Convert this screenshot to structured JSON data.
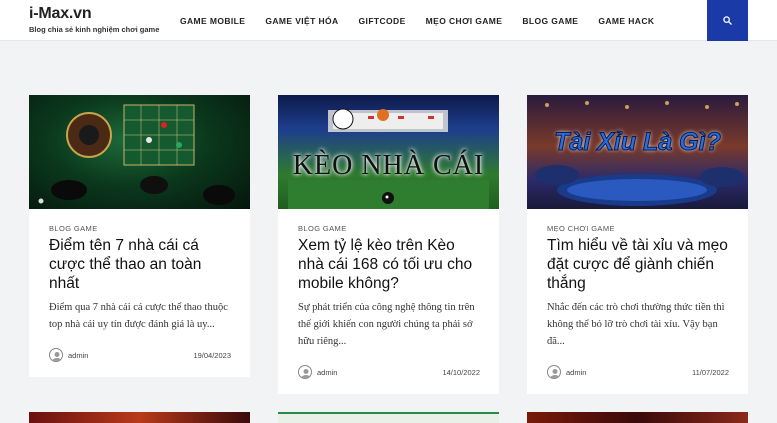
{
  "site": {
    "title": "i-Max.vn",
    "tagline": "Blog chia sẻ kinh nghiệm chơi game"
  },
  "nav": [
    {
      "label": "GAME MOBILE"
    },
    {
      "label": "GAME VIỆT HÓA"
    },
    {
      "label": "GIFTCODE"
    },
    {
      "label": "MẸO CHƠI GAME"
    },
    {
      "label": "BLOG GAME"
    },
    {
      "label": "GAME HACK"
    }
  ],
  "search": {
    "icon": "search-icon",
    "color": "#1a3aa8"
  },
  "posts": [
    {
      "category": "BLOG GAME",
      "title": "Điểm tên 7 nhà cái cá cược thể thao an toàn nhất",
      "excerpt": "Điểm qua 7 nhà cái cá cược thể thao thuộc top nhà cái uy tín được đánh giá là uy...",
      "author": "admin",
      "date": "19/04/2023"
    },
    {
      "category": "BLOG GAME",
      "title": "Xem tỷ lệ kèo trên Kèo nhà cái 168 có tối ưu cho mobile không?",
      "excerpt": "Sự phát triển của công nghệ thông tin trên thế giới khiến con người chúng ta phải sở hữu riêng...",
      "author": "admin",
      "date": "14/10/2022",
      "image_text": "KÈO NHÀ CÁI"
    },
    {
      "category": "Mẹo chơi game",
      "title": "Tìm hiểu về tài xỉu và mẹo đặt cược để giành chiến thắng",
      "excerpt": "Nhắc đến các trò chơi thường thức tiền thì không thể bỏ lỡ trò chơi tài xỉu. Vậy bạn đã...",
      "author": "admin",
      "date": "11/07/2022",
      "image_text": "Tài Xỉu Là Gì?"
    }
  ]
}
